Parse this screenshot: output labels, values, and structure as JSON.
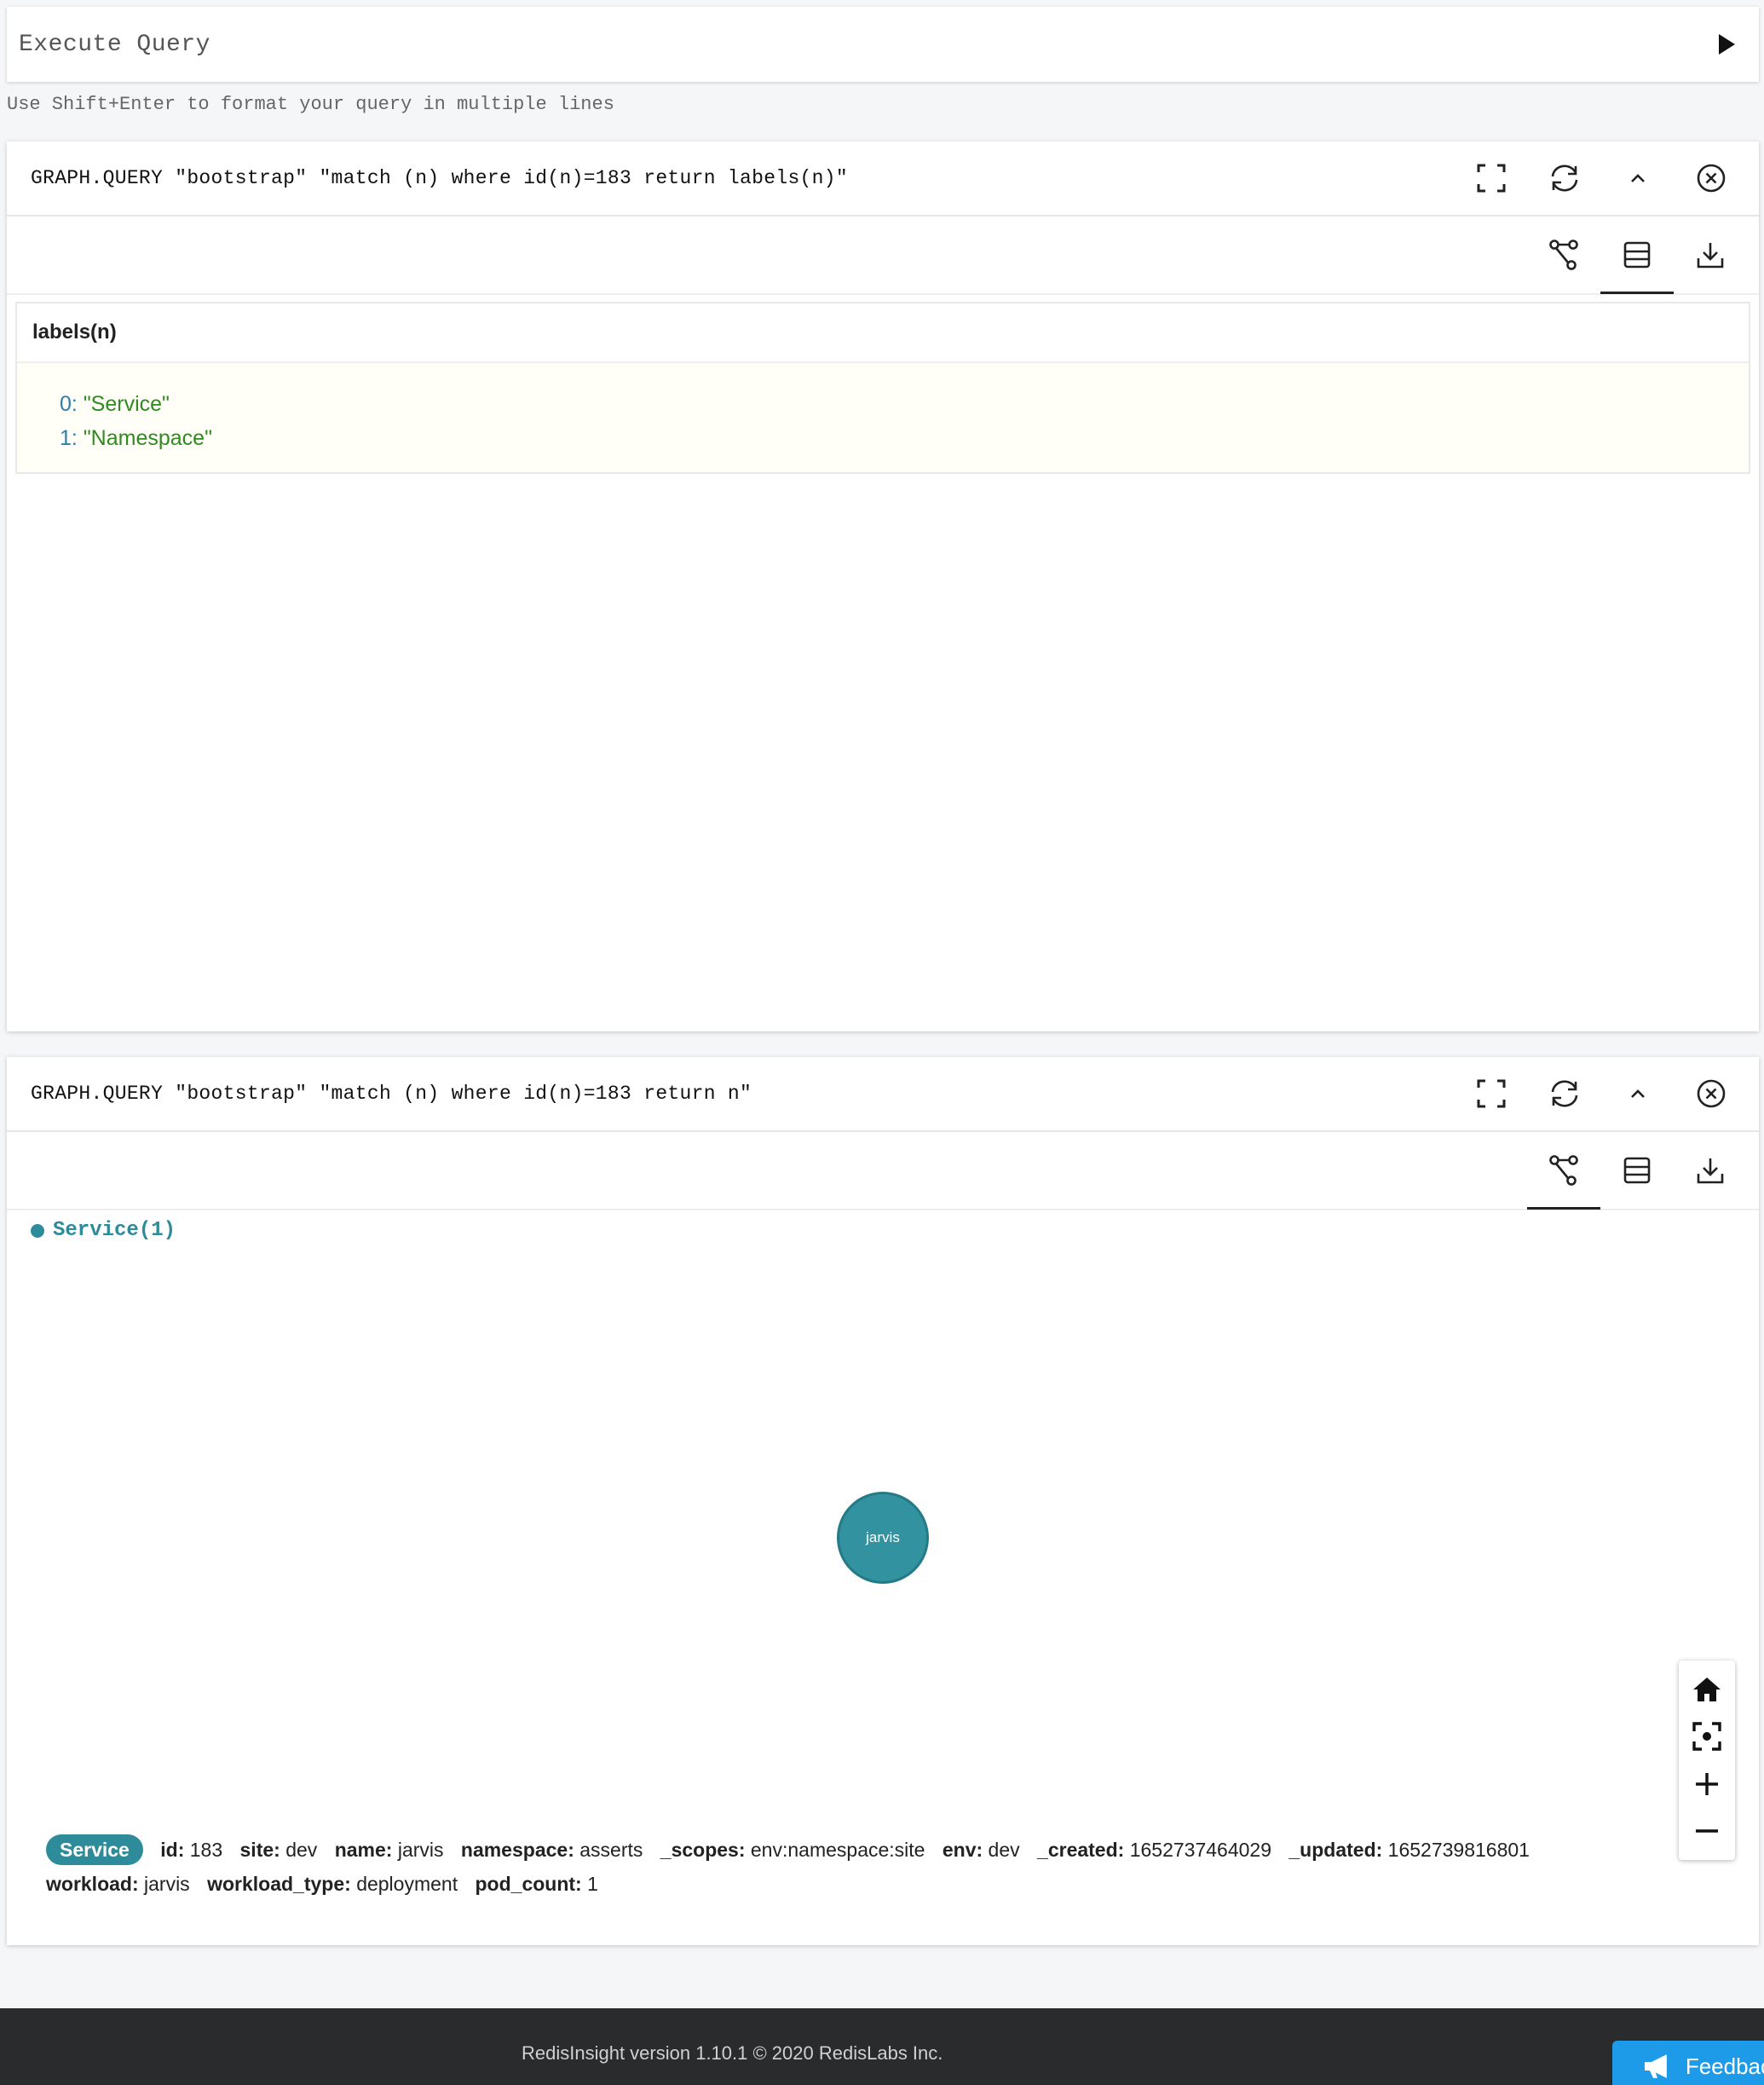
{
  "query_input": {
    "placeholder": "Execute Query",
    "hint": "Use Shift+Enter to format your query in multiple lines"
  },
  "panels": [
    {
      "query": "GRAPH.QUERY \"bootstrap\" \"match (n) where id(n)=183 return labels(n)\"",
      "active_view": "table",
      "table": {
        "column": "labels(n)",
        "rows": [
          {
            "index": "0:",
            "value": "\"Service\""
          },
          {
            "index": "1:",
            "value": "\"Namespace\""
          }
        ]
      }
    },
    {
      "query": "GRAPH.QUERY \"bootstrap\" \"match (n) where id(n)=183 return n\"",
      "active_view": "graph",
      "legend": "Service(1)",
      "node_label": "jarvis",
      "node_color": "#32929f",
      "properties": {
        "label": "Service",
        "items": [
          {
            "key": "id:",
            "value": "183"
          },
          {
            "key": "site:",
            "value": "dev"
          },
          {
            "key": "name:",
            "value": "jarvis"
          },
          {
            "key": "namespace:",
            "value": "asserts"
          },
          {
            "key": "_scopes:",
            "value": "env:namespace:site"
          },
          {
            "key": "env:",
            "value": "dev"
          },
          {
            "key": "_created:",
            "value": "1652737464029"
          },
          {
            "key": "_updated:",
            "value": "1652739816801"
          },
          {
            "key": "workload:",
            "value": "jarvis"
          },
          {
            "key": "workload_type:",
            "value": "deployment"
          },
          {
            "key": "pod_count:",
            "value": "1"
          }
        ]
      }
    }
  ],
  "footer": {
    "version": "RedisInsight version 1.10.1 © 2020 RedisLabs Inc.",
    "feedback": "Feedback"
  },
  "icons": [
    "play-icon",
    "fullscreen-icon",
    "refresh-icon",
    "collapse-icon",
    "close-icon",
    "graph-view-icon",
    "table-view-icon",
    "download-icon",
    "home-icon",
    "focus-icon",
    "zoom-in-icon",
    "zoom-out-icon",
    "megaphone-icon"
  ]
}
